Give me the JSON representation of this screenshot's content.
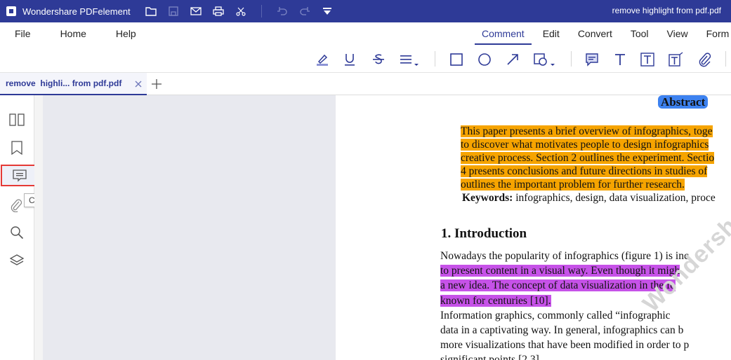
{
  "app": {
    "name": "Wondershare PDFelement",
    "document_title": "remove highlight from pdf.pdf"
  },
  "menus": {
    "left": [
      "File",
      "Home",
      "Help"
    ],
    "right": [
      "Comment",
      "Edit",
      "Convert",
      "Tool",
      "View",
      "Form"
    ],
    "active": "Comment"
  },
  "tab": {
    "label": "remove  highli... from pdf.pdf"
  },
  "tooltip": "Comment",
  "colors": {
    "brand": "#2e3a97",
    "highlight_orange": "#f6a400",
    "highlight_purple": "#c652e8",
    "highlight_blue": "#3d82f0",
    "selection_red": "#e53935"
  },
  "document": {
    "abstract_heading": "Abstract",
    "abstract_lines": [
      "This paper presents a brief overview of infographics, toge",
      "to discover what motivates people to design infographics",
      "creative process. Section 2 outlines the experiment. Sectio",
      "4 presents conclusions and future directions in studies of",
      "outlines the important problem for further research."
    ],
    "keywords_label": "Keywords:",
    "keywords_text": " infographics, design, data visualization, proce",
    "intro_heading": "1.   Introduction",
    "intro_line1": "Nowadays the popularity of infographics (figure 1) is inc",
    "intro_purple": [
      "to present content in a visual way. Even though it migh",
      "a new idea. The concept of data visualization in the fo",
      "known for centuries [10]."
    ],
    "para2": [
      "        Information graphics, commonly called “infographic",
      "data in a captivating way. In general, infographics can b",
      "more visualizations that have been modified in order to p",
      "significant points [2,3]."
    ],
    "watermark": "Wondershare PDFelement"
  }
}
